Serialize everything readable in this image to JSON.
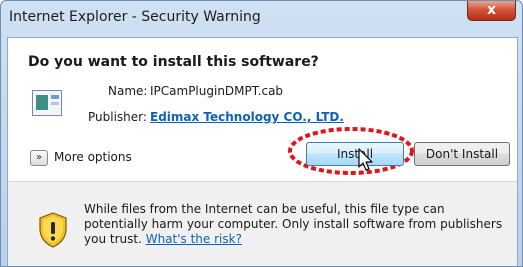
{
  "window": {
    "title": "Internet Explorer - Security Warning",
    "close_glyph": "x"
  },
  "dialog": {
    "question": "Do you want to install this software?",
    "name_label": "Name:",
    "name_value": "IPCamPluginDMPT.cab",
    "publisher_label": "Publisher:",
    "publisher_value": "Edimax Technology CO., LTD.",
    "more_options_glyph": "»",
    "more_options_label": "More options",
    "install_label": "Install",
    "dont_install_label": "Don't Install"
  },
  "warning": {
    "text": "While files from the Internet can be useful, this file type can potentially harm your computer. Only install software from publishers you trust. ",
    "link": "What's the risk?"
  },
  "icons": {
    "file": "cab-file-icon",
    "shield": "security-shield-icon",
    "cursor": "mouse-pointer-icon"
  },
  "colors": {
    "link": "#0d62b7",
    "highlight_ring": "#e0141a",
    "close_button": "#c7432a"
  }
}
